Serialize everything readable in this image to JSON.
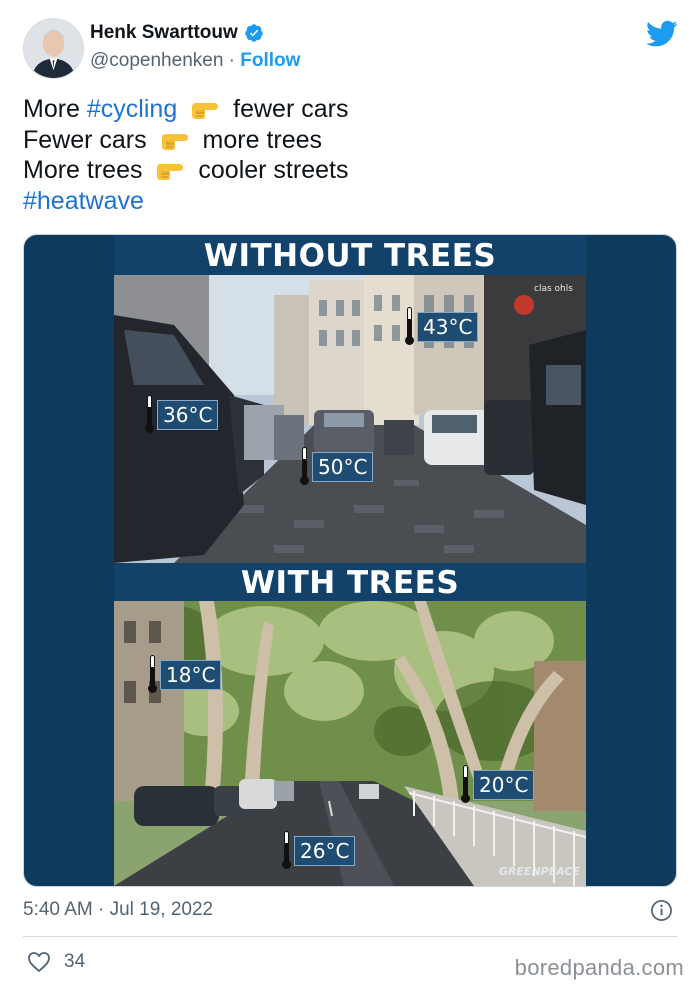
{
  "author": {
    "name": "Henk Swarttouw",
    "handle": "@copenhenken",
    "separator": "·",
    "follow_label": "Follow"
  },
  "tweet": {
    "lines": [
      {
        "pre": "More ",
        "hashtag": "#cycling",
        "post": "fewer cars"
      },
      {
        "pre": "Fewer cars",
        "post": "more trees"
      },
      {
        "pre": "More trees",
        "post": "cooler streets"
      }
    ],
    "final_hashtag": "#heatwave",
    "emoji_name": "backhand-index-pointing-right-emoji"
  },
  "media": {
    "top_title": "WITHOUT TREES",
    "bottom_title": "WITH TREES",
    "temps_without_trees": [
      "43°C",
      "36°C",
      "50°C"
    ],
    "temps_with_trees": [
      "18°C",
      "20°C",
      "26°C"
    ],
    "watermark": "GREENPEACE",
    "storefront_sign": "clas ohls"
  },
  "footer": {
    "timestamp": "5:40 AM · Jul 19, 2022",
    "like_count": "34",
    "site": "boredpanda.com"
  },
  "colors": {
    "link": "#1d9bf0",
    "hashtag": "#1d73d4",
    "panel_bg": "#12426a",
    "secondary_text": "#536471"
  }
}
